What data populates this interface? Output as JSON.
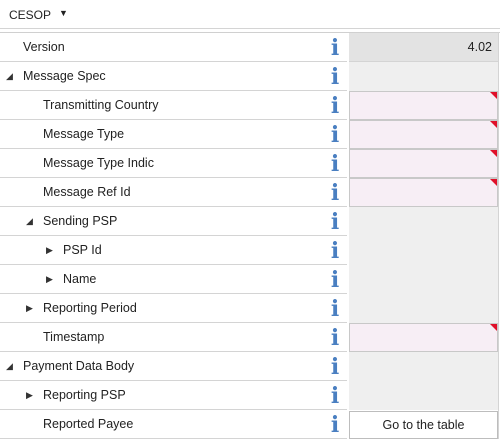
{
  "header": {
    "title": "CESOP",
    "dropdown_icon": "caret-down-icon"
  },
  "colors": {
    "required_fill": "#f7eef5",
    "required_marker": "#e0102a",
    "readonly_fill": "#e3e3e3",
    "info_icon": "#4a7fc1"
  },
  "rows": [
    {
      "label": "Version",
      "value": "4.02"
    },
    {
      "label": "Message Spec"
    },
    {
      "label": "Transmitting Country",
      "value": ""
    },
    {
      "label": "Message Type",
      "value": ""
    },
    {
      "label": "Message Type Indic",
      "value": ""
    },
    {
      "label": "Message Ref Id",
      "value": ""
    },
    {
      "label": "Sending PSP"
    },
    {
      "label": "PSP Id"
    },
    {
      "label": "Name"
    },
    {
      "label": "Reporting Period"
    },
    {
      "label": "Timestamp",
      "value": ""
    },
    {
      "label": "Payment Data Body"
    },
    {
      "label": "Reporting PSP"
    },
    {
      "label": "Reported Payee",
      "button": "Go to the table"
    }
  ]
}
